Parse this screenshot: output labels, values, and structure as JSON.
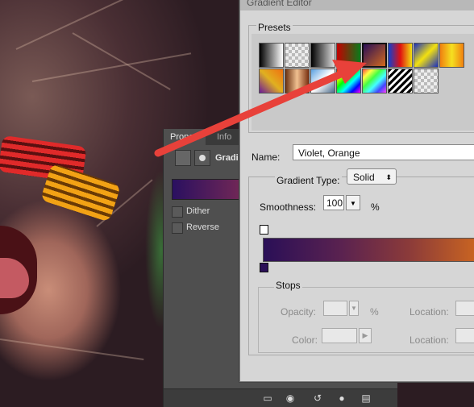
{
  "dialog": {
    "title": "Gradient Editor",
    "presets_label": "Presets",
    "presets": [
      "black-white",
      "transparent-checker",
      "black-transparent",
      "red-green",
      "violet-orange",
      "blue-red-yellow",
      "blue-yellow-blue",
      "orange-yellow-orange",
      "violet-green-orange",
      "copper",
      "chrome",
      "spectrum",
      "transparent-rainbow",
      "transparent-stripes",
      "neutral-density"
    ],
    "name_label": "Name:",
    "name_value": "Violet, Orange",
    "gradient_type_label": "Gradient Type:",
    "gradient_type_value": "Solid",
    "smoothness_label": "Smoothness:",
    "smoothness_value": "100",
    "smoothness_unit": "%",
    "stops_label": "Stops",
    "opacity_label": "Opacity:",
    "opacity_unit": "%",
    "location_label": "Location:",
    "color_label": "Color:",
    "gradient_colors": [
      "#2a0f57",
      "#d26a1e"
    ]
  },
  "properties": {
    "tab_active": "Propert",
    "tab_second": "Info",
    "gradient_label": "Gradie",
    "dither_label": "Dither",
    "reverse_label": "Reverse"
  },
  "colors": {
    "annotation_arrow": "#e8413a"
  }
}
